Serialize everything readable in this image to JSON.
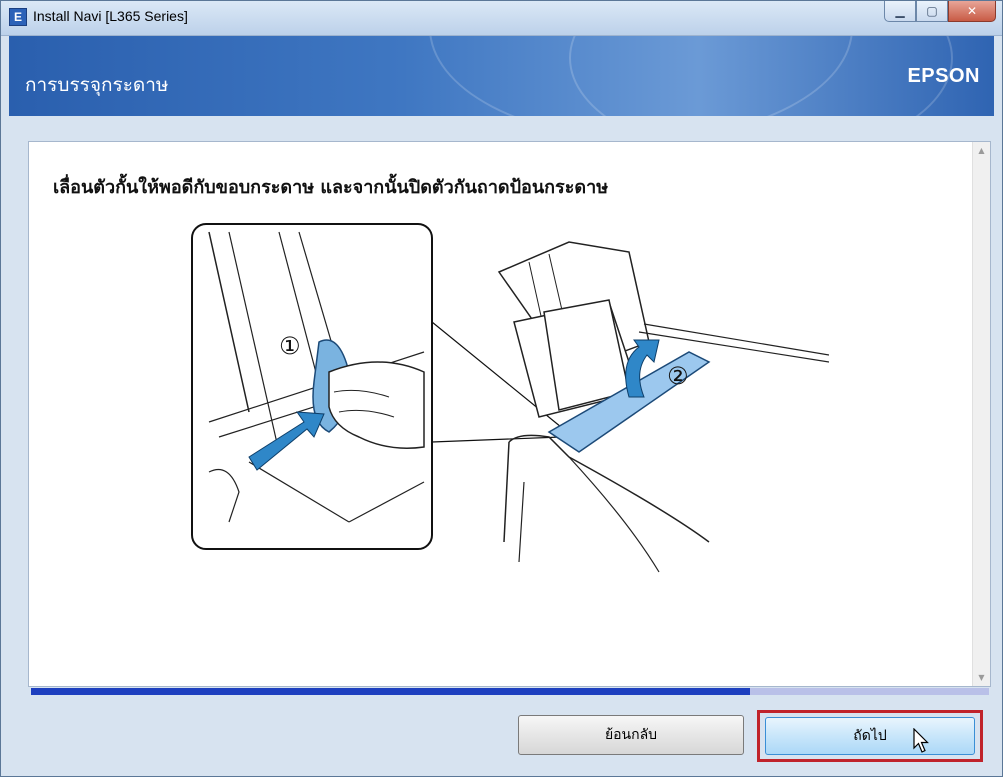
{
  "window": {
    "title": "Install Navi [L365 Series]",
    "app_icon_letter": "E",
    "min_icon": "minimize-icon",
    "max_icon": "maximize-icon",
    "close_icon": "close-icon"
  },
  "header": {
    "title": "การบรรจุกระดาษ",
    "brand": "EPSON"
  },
  "main": {
    "instruction": "เลื่อนตัวกั้นให้พอดีกับขอบกระดาษ และจากนั้นปิดตัวกันถาดป้อนกระดาษ",
    "step_markers": [
      "①",
      "②"
    ]
  },
  "progress": {
    "fraction": 0.75
  },
  "buttons": {
    "back_label": "ย้อนกลับ",
    "next_label": "ถัดไป"
  },
  "colors": {
    "header_blue": "#2a5fae",
    "progress_fill": "#1d3fbf",
    "highlight_red": "#c0232b",
    "illustration_blue": "#7ab3e0"
  }
}
